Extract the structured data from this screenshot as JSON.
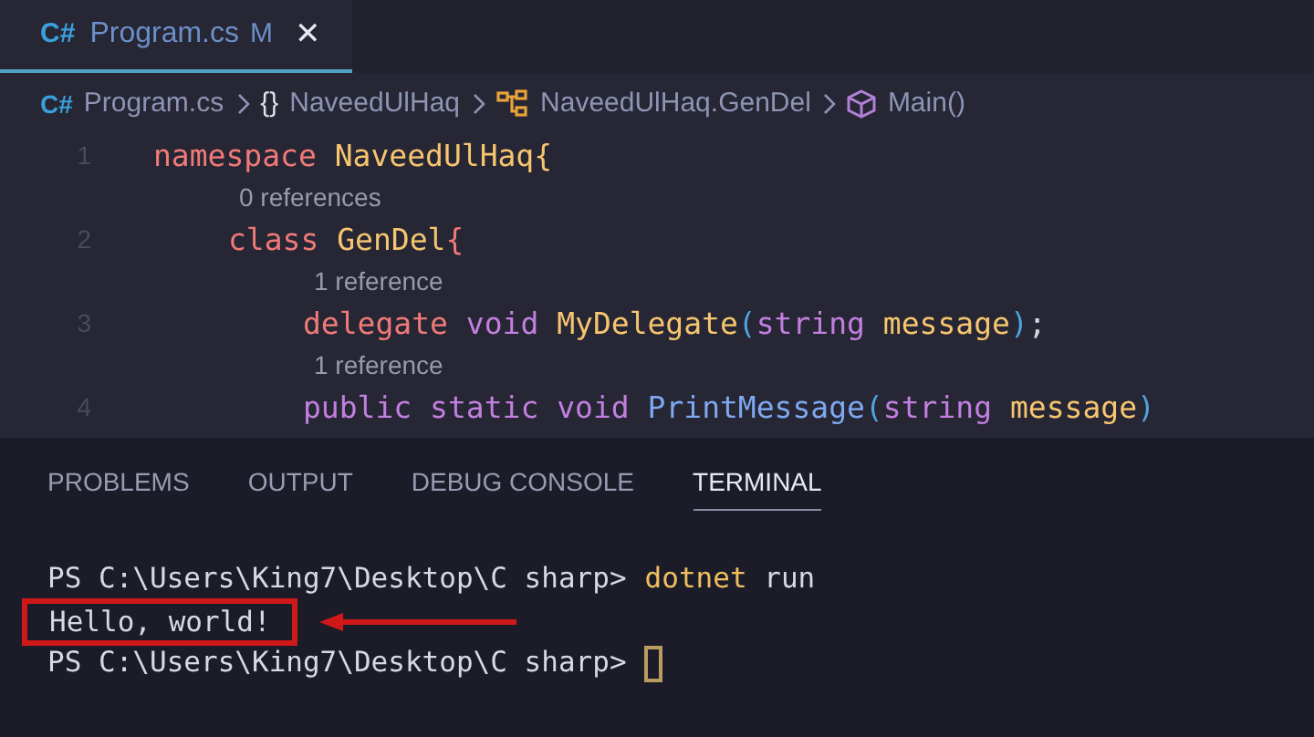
{
  "tabs": [
    {
      "icon_text": "C#",
      "label": "Program.cs",
      "badge": "M",
      "close": "✕",
      "selected": true
    }
  ],
  "breadcrumbs": [
    {
      "kind": "csharp",
      "icon_text": "C#",
      "label": "Program.cs"
    },
    {
      "kind": "namespace",
      "icon_text": "{}",
      "label": "NaveedUlHaq"
    },
    {
      "kind": "class",
      "label": "NaveedUlHaq.GenDel"
    },
    {
      "kind": "method",
      "label": "Main()"
    }
  ],
  "code": [
    {
      "number": "1",
      "tokens": [
        {
          "text": "namespace ",
          "kind": "keyword"
        },
        {
          "text": "NaveedUlHaq",
          "kind": "type"
        },
        {
          "text": "{",
          "kind": "type"
        }
      ],
      "children": [
        {
          "number": "2",
          "codelens": "0 references",
          "tokens": [
            {
              "text": "class ",
              "kind": "keyword"
            },
            {
              "text": "GenDel",
              "kind": "type"
            },
            {
              "text": "{",
              "kind": "keyword"
            }
          ],
          "children": [
            {
              "number": "3",
              "codelens": "1 reference",
              "tokens": [
                {
                  "text": "delegate ",
                  "kind": "keyword"
                },
                {
                  "text": "void ",
                  "kind": "modifier"
                },
                {
                  "text": "MyDelegate",
                  "kind": "type"
                },
                {
                  "text": "(",
                  "kind": "punct"
                },
                {
                  "text": "string ",
                  "kind": "modifier"
                },
                {
                  "text": "message",
                  "kind": "type"
                },
                {
                  "text": ")",
                  "kind": "punct"
                },
                {
                  "text": ";",
                  "kind": "plain"
                }
              ]
            },
            {
              "number": "4",
              "codelens": "1 reference",
              "tokens": [
                {
                  "text": "public ",
                  "kind": "modifier"
                },
                {
                  "text": "static ",
                  "kind": "modifier"
                },
                {
                  "text": "void ",
                  "kind": "modifier"
                },
                {
                  "text": "PrintMessage",
                  "kind": "function"
                },
                {
                  "text": "(",
                  "kind": "punct"
                },
                {
                  "text": "string ",
                  "kind": "modifier"
                },
                {
                  "text": "message",
                  "kind": "type"
                },
                {
                  "text": ")",
                  "kind": "punct"
                }
              ]
            }
          ]
        }
      ]
    }
  ],
  "panel_tabs": [
    {
      "label": "PROBLEMS",
      "selected": false
    },
    {
      "label": "OUTPUT",
      "selected": false
    },
    {
      "label": "DEBUG CONSOLE",
      "selected": false
    },
    {
      "label": "TERMINAL",
      "selected": true
    }
  ],
  "terminal": [
    {
      "kind": "prompt",
      "prompt": "PS C:\\Users\\King7\\Desktop\\C sharp>",
      "command": [
        {
          "text": "dotnet",
          "kind": "program"
        },
        {
          "text": "run",
          "kind": "plain"
        }
      ]
    },
    {
      "kind": "output",
      "text": "Hello, world!",
      "highlighted": true
    },
    {
      "kind": "prompt",
      "prompt": "PS C:\\Users\\King7\\Desktop\\C sharp>",
      "cursor": true
    }
  ]
}
